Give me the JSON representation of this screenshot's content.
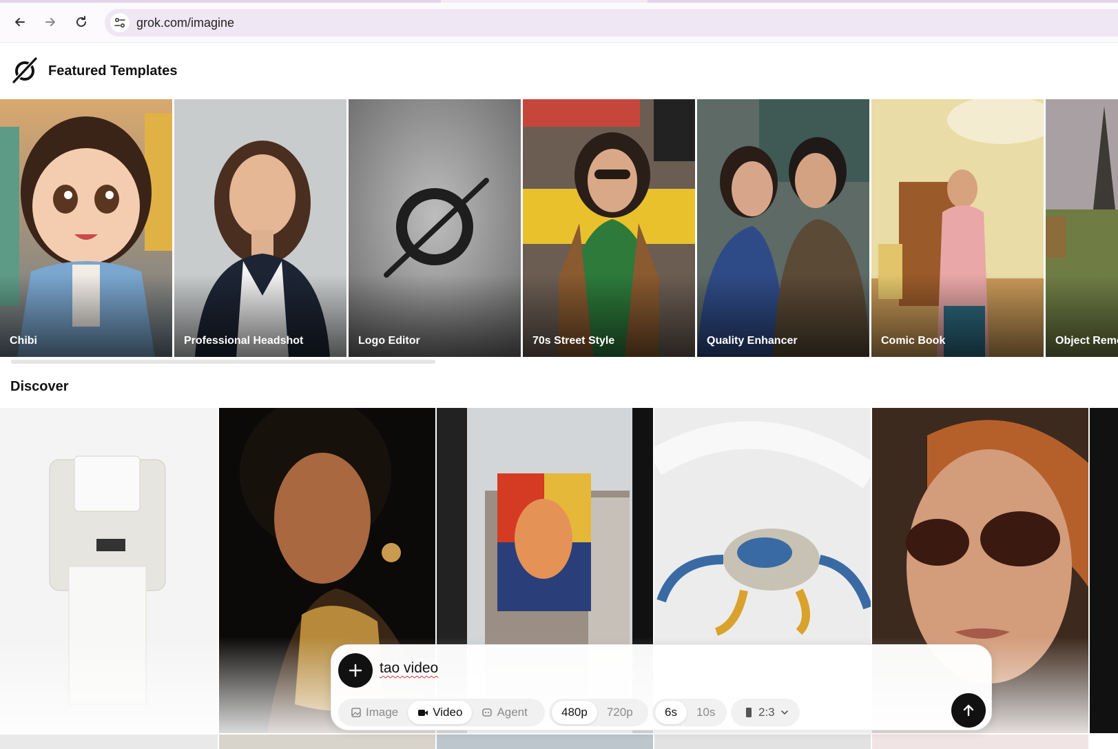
{
  "browser": {
    "url": "grok.com/imagine",
    "icons": [
      "back-arrow-icon",
      "forward-arrow-icon",
      "reload-icon",
      "site-settings-icon"
    ]
  },
  "header": {
    "title": "Featured Templates",
    "logo_icon": "grok-logo-icon"
  },
  "templates": [
    {
      "label": "Chibi"
    },
    {
      "label": "Professional Headshot"
    },
    {
      "label": "Logo Editor"
    },
    {
      "label": "70s Street Style"
    },
    {
      "label": "Quality Enhancer"
    },
    {
      "label": "Comic Book"
    },
    {
      "label": "Object Remo"
    }
  ],
  "discover": {
    "title": "Discover"
  },
  "composer": {
    "prompt_text": "tao video",
    "mode_options": [
      {
        "label": "Image",
        "icon": "image-icon",
        "active": false
      },
      {
        "label": "Video",
        "icon": "video-camera-icon",
        "active": true
      },
      {
        "label": "Agent",
        "icon": "agent-icon",
        "active": false
      }
    ],
    "resolution_options": [
      {
        "label": "480p",
        "active": true
      },
      {
        "label": "720p",
        "active": false
      }
    ],
    "duration_options": [
      {
        "label": "6s",
        "active": true
      },
      {
        "label": "10s",
        "active": false
      }
    ],
    "aspect_ratio": {
      "label": "2:3",
      "icon": "portrait-ratio-icon"
    },
    "attach_icon": "plus-icon",
    "send_icon": "arrow-up-icon"
  },
  "colors": {
    "accent": "#111111",
    "omnibox": "#efe7f4"
  }
}
